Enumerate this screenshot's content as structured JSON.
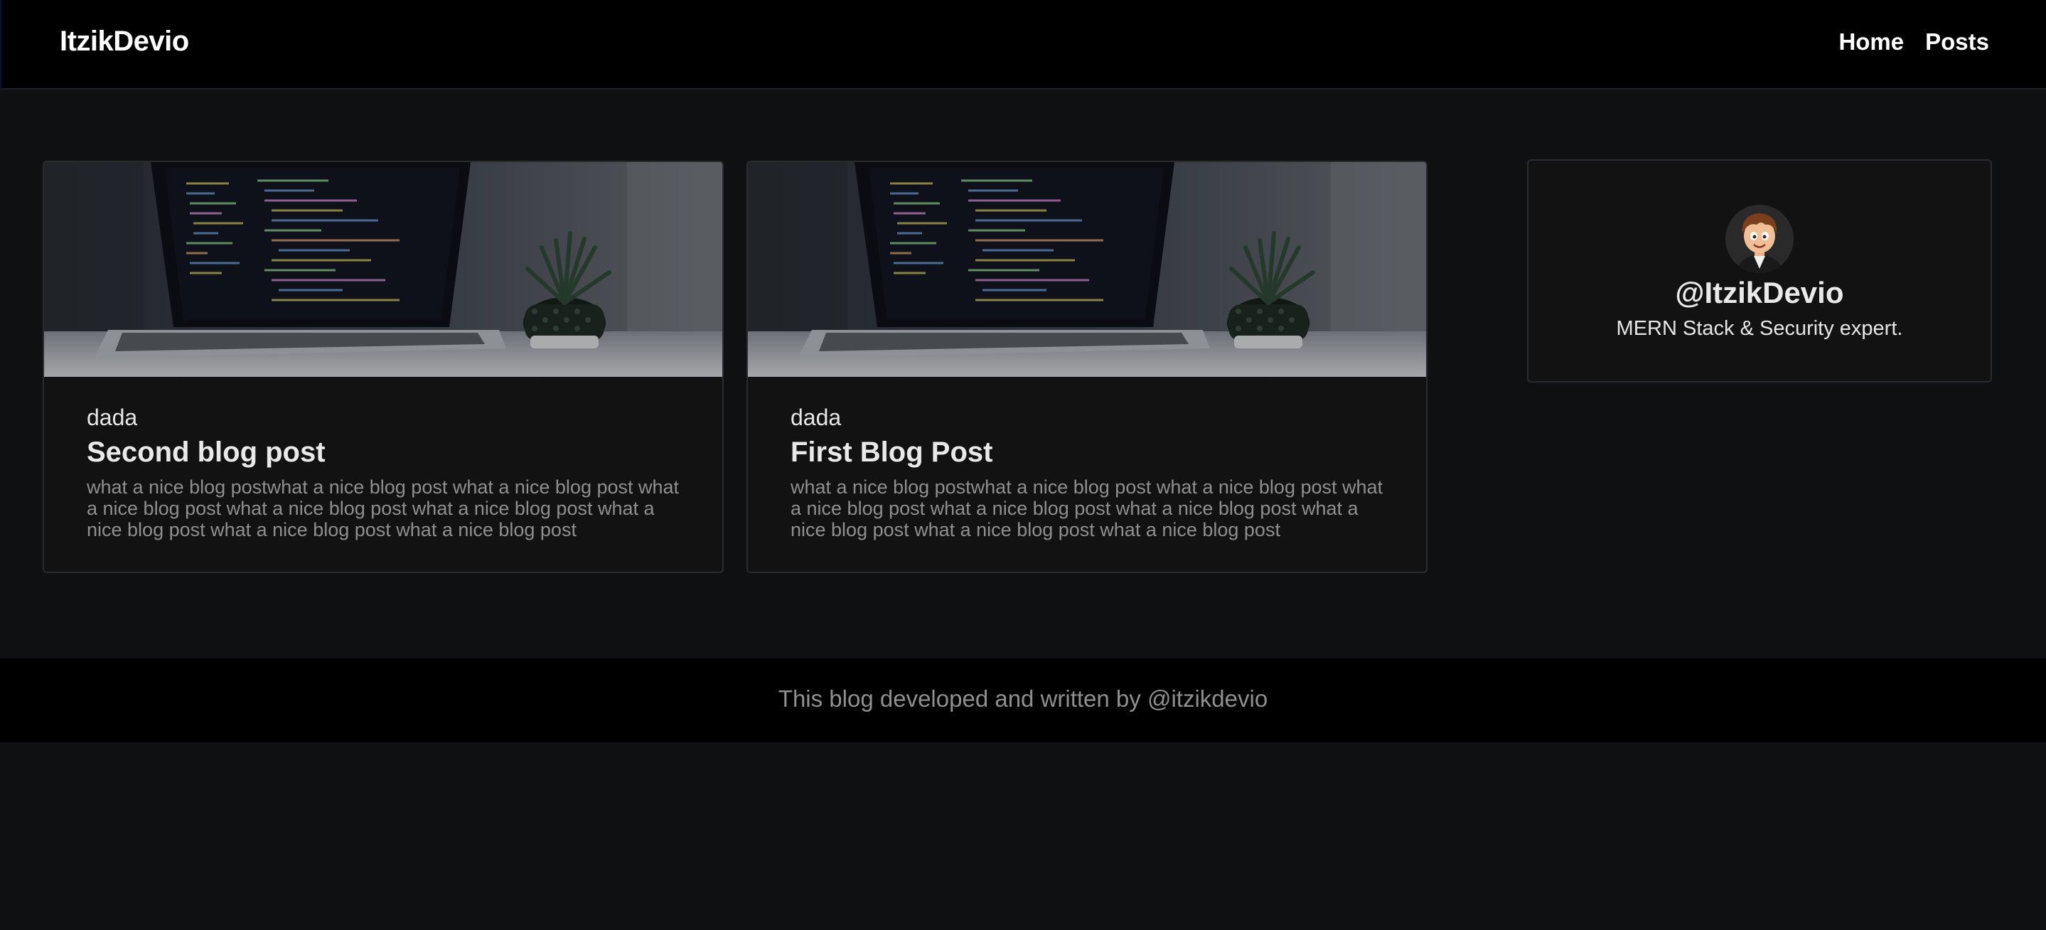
{
  "header": {
    "brand": "ItzikDevio",
    "nav": [
      {
        "label": "Home"
      },
      {
        "label": "Posts"
      }
    ]
  },
  "posts": [
    {
      "author": "dada",
      "title": "Second blog post",
      "excerpt": "what a nice blog postwhat a nice blog post what a nice blog post what a nice blog post what a nice blog post what a nice blog post what a nice blog post what a nice blog post what a nice blog post",
      "image": "laptop-code-plant-image"
    },
    {
      "author": "dada",
      "title": "First Blog Post",
      "excerpt": "what a nice blog postwhat a nice blog post what a nice blog post what a nice blog post what a nice blog post what a nice blog post what a nice blog post what a nice blog post what a nice blog post",
      "image": "laptop-code-plant-image"
    }
  ],
  "profile": {
    "handle": "@ItzikDevio",
    "bio": "MERN Stack & Security expert.",
    "avatar": "cartoon-avatar-icon"
  },
  "footer": {
    "text": "This blog developed and written by @itzikdevio"
  },
  "colors": {
    "page_bg": "#0f1012",
    "header_bg": "#000000",
    "card_bg": "#121212",
    "card_border": "#2a2b2f",
    "muted_text": "#8f8f8f"
  }
}
